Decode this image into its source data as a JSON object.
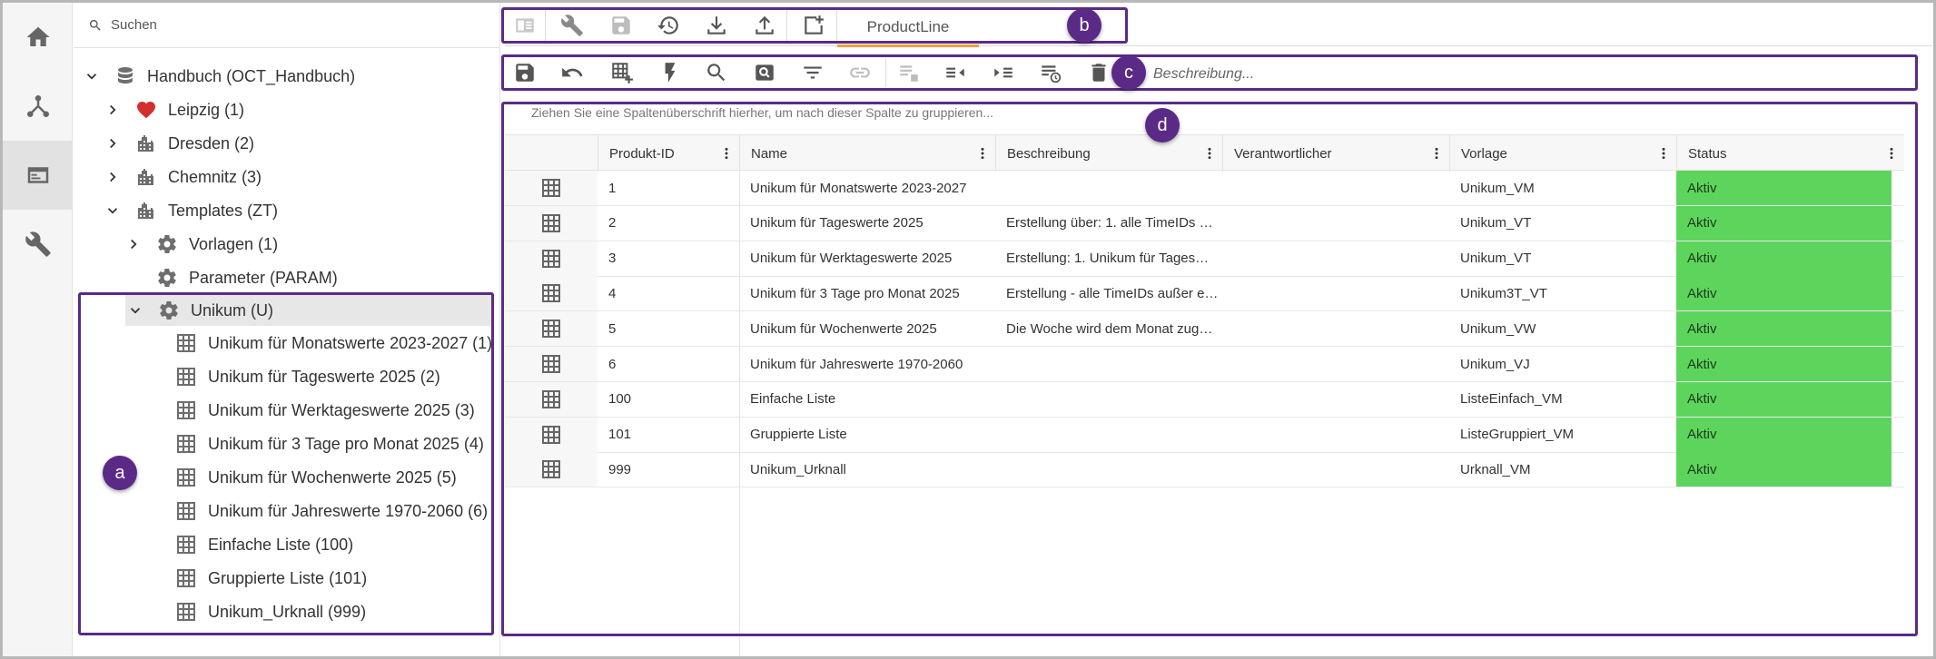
{
  "nav": {
    "items": [
      {
        "icon": "home-icon",
        "active": false
      },
      {
        "icon": "network-icon",
        "active": false
      },
      {
        "icon": "layout-icon",
        "active": true
      },
      {
        "icon": "wrench-icon",
        "active": false
      }
    ]
  },
  "search": {
    "placeholder": "Suchen"
  },
  "tree": {
    "root": "Handbuch (OCT_Handbuch)",
    "items": [
      {
        "label": "Leipzig (1)",
        "icon": "heart-icon"
      },
      {
        "label": "Dresden (2)",
        "icon": "city-icon"
      },
      {
        "label": "Chemnitz (3)",
        "icon": "city-icon"
      },
      {
        "label": "Templates (ZT)",
        "icon": "city-icon"
      },
      {
        "label": "Vorlagen (1)",
        "icon": "gear-icon"
      },
      {
        "label": "Parameter (PARAM)",
        "icon": "gear-icon"
      },
      {
        "label": "Unikum (U)",
        "icon": "gear-icon"
      }
    ],
    "children": [
      "Unikum für Monatswerte 2023-2027 (1)",
      "Unikum für Tageswerte 2025 (2)",
      "Unikum für Werktageswerte 2025 (3)",
      "Unikum für 3 Tage pro Monat 2025 (4)",
      "Unikum für Wochenwerte 2025 (5)",
      "Unikum für Jahreswerte 1970-2060 (6)",
      "Einfache Liste (100)",
      "Gruppierte Liste (101)",
      "Unikum_Urknall (999)"
    ]
  },
  "top_toolbar": {
    "tab_label": "ProductLine",
    "buttons": [
      "panel-icon",
      "wrench-icon",
      "save-icon",
      "history-icon",
      "download-icon",
      "upload-icon",
      "add-window-icon"
    ]
  },
  "edit_toolbar": {
    "buttons": [
      "save-icon",
      "undo-icon",
      "add-grid-icon",
      "lightning-icon",
      "search-icon",
      "preview-icon",
      "filter-icon",
      "link-icon",
      "list-save-icon",
      "collapse-icon",
      "expand-icon",
      "list-history-icon",
      "delete-icon"
    ],
    "description_placeholder": "Beschreibung..."
  },
  "grid": {
    "group_hint": "Ziehen Sie eine Spaltenüberschrift hierher, um nach dieser Spalte zu gruppieren...",
    "columns": [
      "",
      "Produkt-ID",
      "Name",
      "Beschreibung",
      "Verantwortlicher",
      "Vorlage",
      "Status"
    ],
    "rows": [
      [
        "1",
        "Unikum für Monatswerte 2023-2027",
        "",
        "",
        "Unikum_VM",
        "Aktiv"
      ],
      [
        "2",
        "Unikum für Tageswerte 2025",
        "Erstellung über: 1. alle TimeIDs …",
        "",
        "Unikum_VT",
        "Aktiv"
      ],
      [
        "3",
        "Unikum für Werktageswerte 2025",
        "Erstellung: 1. Unikum für Tages…",
        "",
        "Unikum_VT",
        "Aktiv"
      ],
      [
        "4",
        "Unikum für 3 Tage pro Monat 2025",
        "Erstellung - alle TimeIDs außer e…",
        "",
        "Unikum3T_VT",
        "Aktiv"
      ],
      [
        "5",
        "Unikum für Wochenwerte 2025",
        "Die Woche wird dem Monat zug…",
        "",
        "Unikum_VW",
        "Aktiv"
      ],
      [
        "6",
        "Unikum für Jahreswerte 1970-2060",
        "",
        "",
        "Unikum_VJ",
        "Aktiv"
      ],
      [
        "100",
        "Einfache Liste",
        "",
        "",
        "ListeEinfach_VM",
        "Aktiv"
      ],
      [
        "101",
        "Gruppierte Liste",
        "",
        "",
        "ListeGruppiert_VM",
        "Aktiv"
      ],
      [
        "999",
        "Unikum_Urknall",
        "",
        "",
        "Urknall_VM",
        "Aktiv"
      ]
    ]
  },
  "markers": {
    "a": "a",
    "b": "b",
    "c": "c",
    "d": "d"
  },
  "colors": {
    "highlight": "#5b2a86",
    "status_active": "#5dd55d",
    "heart": "#d32f2f",
    "tab_accent": "#f3a03a"
  }
}
